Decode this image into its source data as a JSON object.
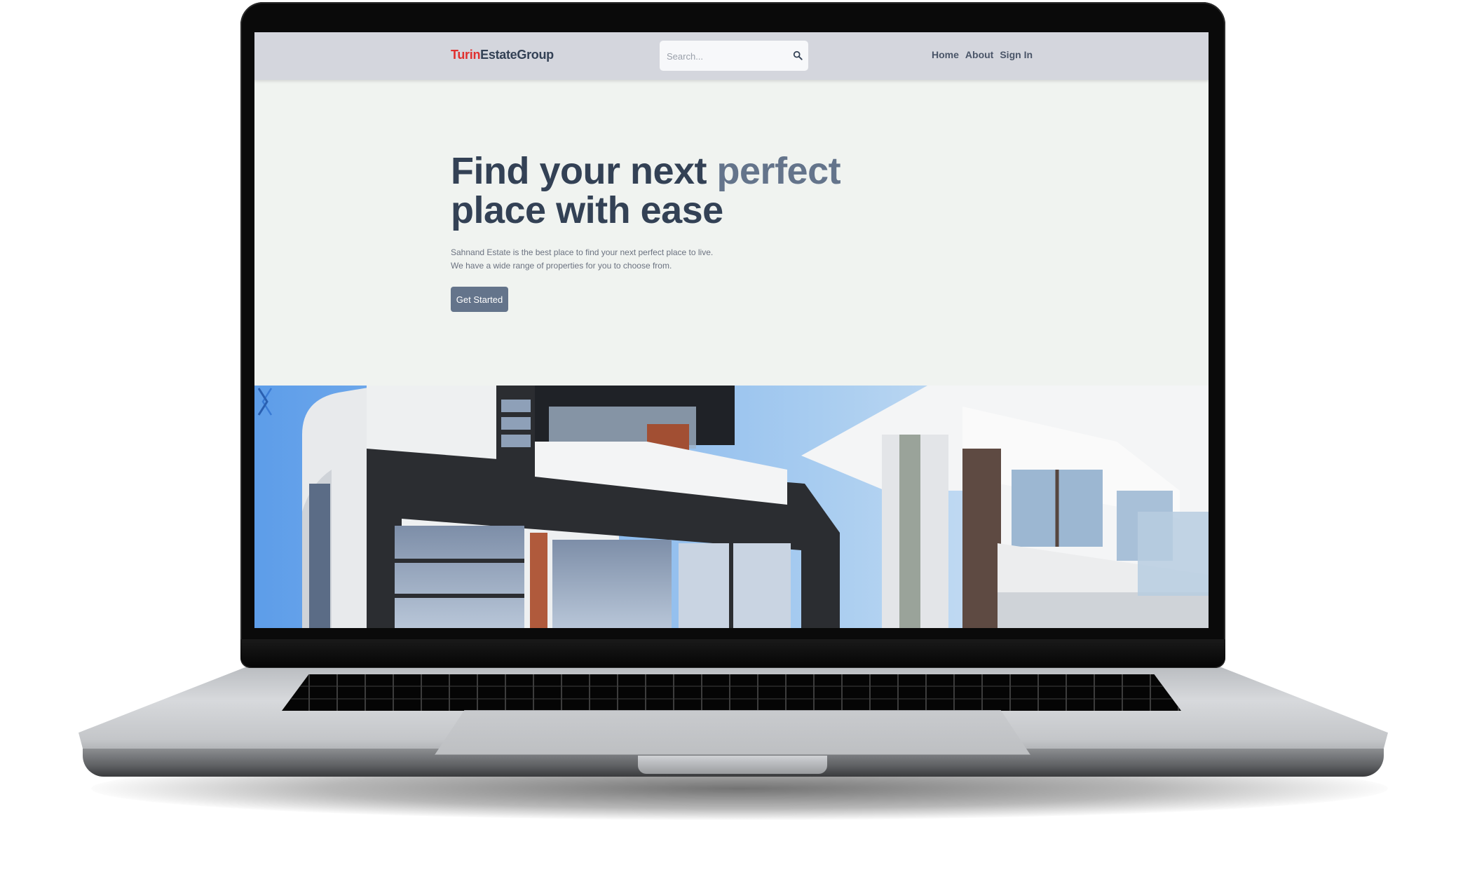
{
  "brand": {
    "part1": "Turin",
    "part2": "EstateGroup",
    "accent_color": "#e0312f"
  },
  "search": {
    "placeholder": "Search...",
    "icon": "search-icon"
  },
  "nav": {
    "items": [
      "Home",
      "About",
      "Sign In"
    ]
  },
  "hero": {
    "title_main": "Find your next ",
    "title_accent": "perfect",
    "title_line2": "place with ease",
    "description_line1": "Sahnand Estate is the best place to find your next perfect place to live.",
    "description_line2": "We have a wide range of properties for you to choose from.",
    "cta_label": "Get Started"
  },
  "carousel": {
    "prev_icon": "chevron-left-icon",
    "next_icon": "chevron-right-icon",
    "image": "modern-building-photo"
  },
  "colors": {
    "header_bg": "#d4d6dd",
    "page_bg": "#f0f3f0",
    "heading": "#334155",
    "accent_text": "#64748b",
    "button_bg": "#64748b"
  }
}
